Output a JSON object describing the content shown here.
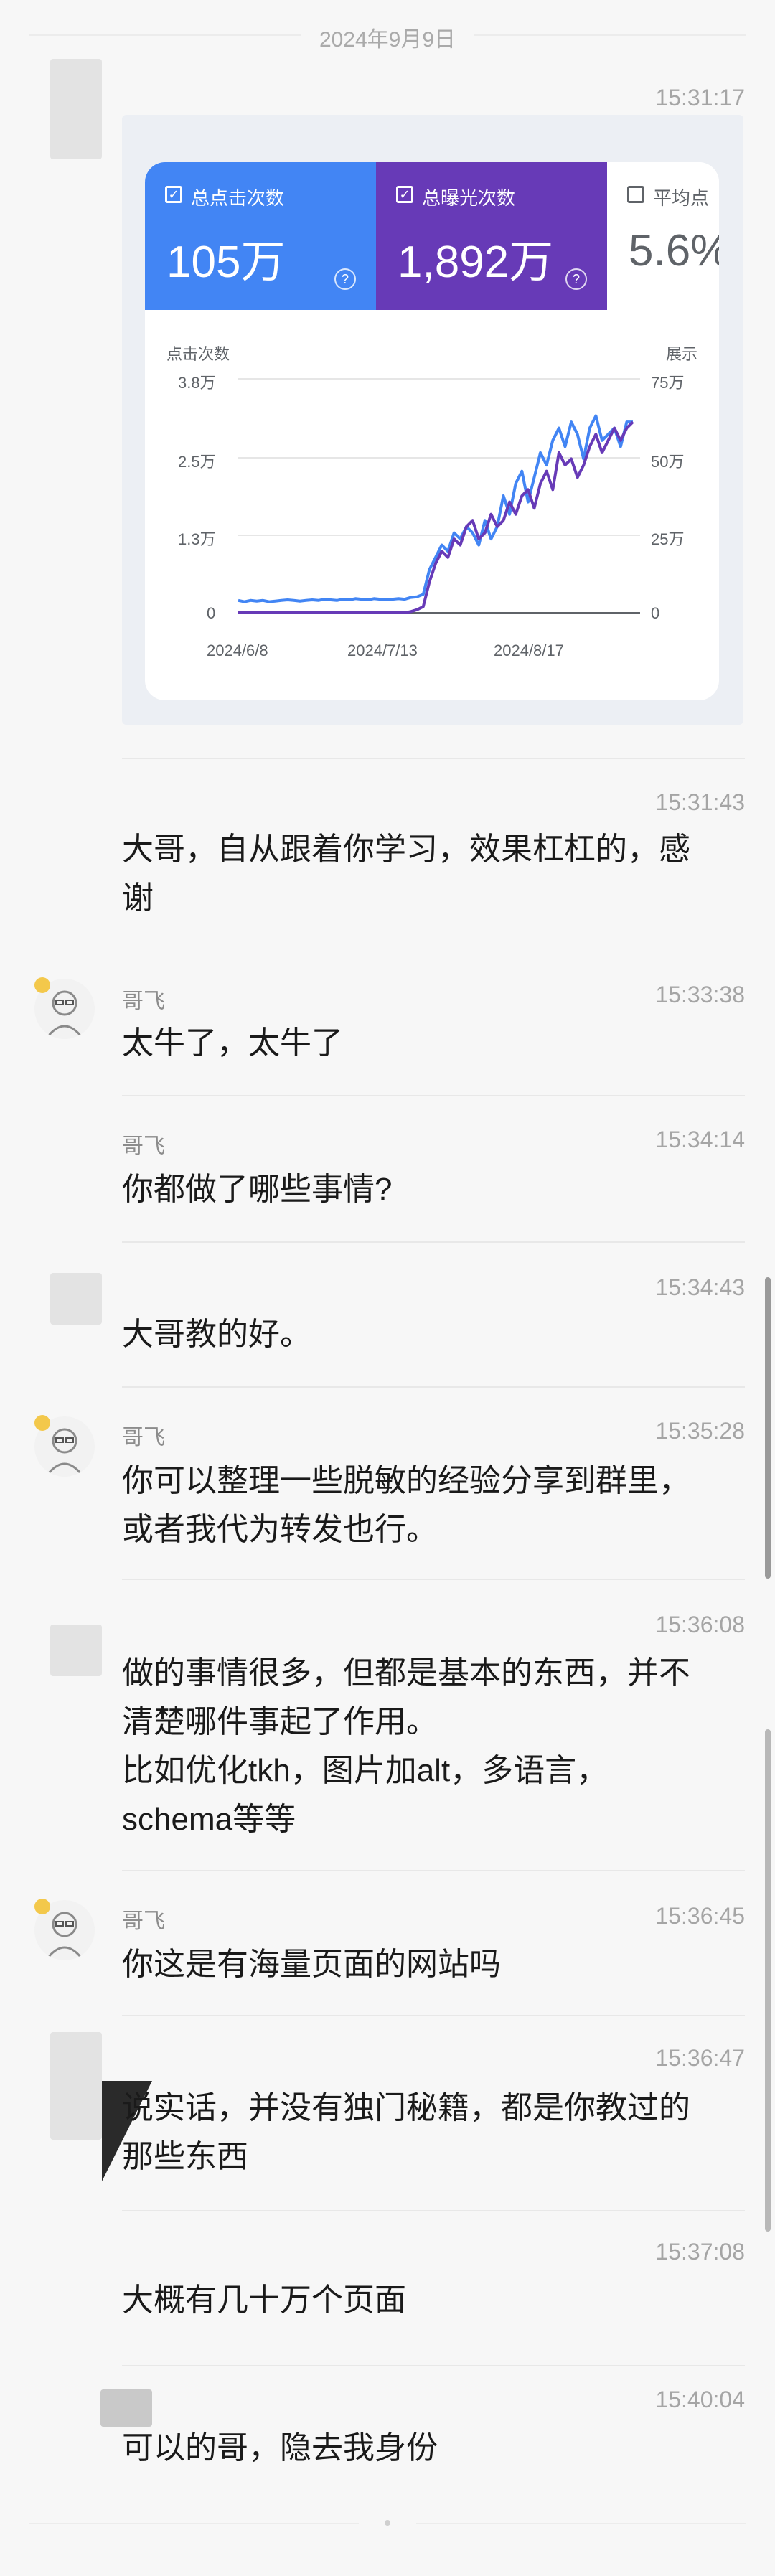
{
  "date_separator": "2024年9月9日",
  "sender_name": "哥飞",
  "shared_screenshot": {
    "metrics": [
      {
        "label": "总点击次数",
        "value": "105万",
        "color": "#4285f4",
        "checked": true
      },
      {
        "label": "总曝光次数",
        "value": "1,892万",
        "color": "#673ab7",
        "checked": true
      },
      {
        "label": "平均点",
        "value": "5.6%",
        "checked": false
      }
    ],
    "chart_data": {
      "type": "line",
      "ylabel_left": "点击次数",
      "ylabel_right": "展示",
      "left_ticks": [
        "3.8万",
        "2.5万",
        "1.3万",
        "0"
      ],
      "right_ticks": [
        "75万",
        "50万",
        "25万",
        "0"
      ],
      "x_ticks": [
        "2024/6/8",
        "2024/7/13",
        "2024/8/17"
      ],
      "series": [
        {
          "color": "#4285f4",
          "values": [
            0.2,
            0.18,
            0.2,
            0.19,
            0.2,
            0.18,
            0.19,
            0.2,
            0.21,
            0.2,
            0.19,
            0.2,
            0.21,
            0.2,
            0.22,
            0.21,
            0.2,
            0.22,
            0.21,
            0.23,
            0.22,
            0.21,
            0.23,
            0.22,
            0.21,
            0.22,
            0.23,
            0.22,
            0.25,
            0.26,
            0.3,
            0.7,
            0.9,
            1.1,
            1.0,
            1.3,
            1.2,
            1.4,
            1.3,
            1.1,
            1.5,
            1.2,
            1.4,
            1.9,
            1.6,
            2.1,
            2.3,
            1.8,
            2.2,
            2.6,
            2.4,
            2.8,
            3.0,
            2.7,
            3.1,
            2.9,
            2.5,
            3.0,
            3.2,
            2.8,
            2.9,
            3.0,
            2.7,
            3.1,
            3.1
          ]
        },
        {
          "color": "#673ab7",
          "values": [
            0.0,
            0.0,
            0.0,
            0.0,
            0.0,
            0.0,
            0.0,
            0.0,
            0.0,
            0.0,
            0.0,
            0.0,
            0.0,
            0.0,
            0.0,
            0.0,
            0.0,
            0.0,
            0.0,
            0.0,
            0.0,
            0.0,
            0.0,
            0.0,
            0.0,
            0.0,
            0.0,
            0.0,
            0.02,
            0.05,
            0.1,
            0.5,
            0.8,
            1.0,
            0.9,
            1.2,
            1.1,
            1.4,
            1.5,
            1.2,
            1.3,
            1.6,
            1.4,
            1.5,
            1.8,
            1.6,
            1.9,
            2.0,
            1.7,
            2.1,
            2.3,
            2.0,
            2.6,
            2.4,
            2.5,
            2.2,
            2.4,
            2.7,
            2.9,
            2.6,
            2.8,
            3.0,
            2.8,
            3.0,
            3.1
          ]
        }
      ]
    }
  },
  "messages": [
    {
      "time": "15:31:17"
    },
    {
      "time": "15:31:43",
      "text": "大哥，自从跟着你学习，效果杠杠的，感\n谢"
    },
    {
      "time": "15:33:38",
      "text": "太牛了，太牛了"
    },
    {
      "time": "15:34:14",
      "text": "你都做了哪些事情?"
    },
    {
      "time": "15:34:43",
      "text": "大哥教的好。"
    },
    {
      "time": "15:35:28",
      "text": "你可以整理一些脱敏的经验分享到群里，\n或者我代为转发也行。"
    },
    {
      "time": "15:36:08",
      "text": "做的事情很多，但都是基本的东西，并不\n清楚哪件事起了作用。\n比如优化tkh，图片加alt，多语言，\nschema等等"
    },
    {
      "time": "15:36:45",
      "text": "你这是有海量页面的网站吗"
    },
    {
      "time": "15:36:47",
      "text": "说实话，并没有独门秘籍，都是你教过的\n那些东西"
    },
    {
      "time": "15:37:08",
      "text": "大概有几十万个页面"
    },
    {
      "time": "15:40:04",
      "text": "可以的哥，隐去我身份"
    }
  ]
}
